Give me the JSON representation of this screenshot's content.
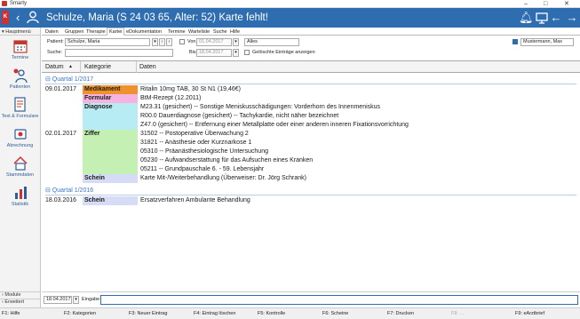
{
  "window": {
    "title": "Smarty",
    "controls": [
      "–",
      "□",
      "✕"
    ]
  },
  "header": {
    "red_tab": "K",
    "patient_title": "Schulze, Maria (S 24 03 65, Alter: 52) Karte fehlt!",
    "icons": [
      "bell-icon",
      "screen-icon",
      "back-icon",
      "forward-icon",
      "menu-icon"
    ]
  },
  "sidebar": {
    "title": "Hauptmenü",
    "items": [
      {
        "label": "Termine",
        "icon": "calendar-icon"
      },
      {
        "label": "Patienten",
        "icon": "patients-icon"
      },
      {
        "label": "Text & Formulare",
        "icon": "document-icon"
      },
      {
        "label": "Abrechnung",
        "icon": "billing-icon"
      },
      {
        "label": "Stammdaten",
        "icon": "house-icon"
      },
      {
        "label": "Statistik",
        "icon": "chart-icon"
      }
    ],
    "bottom": [
      "Module",
      "Erweitert"
    ]
  },
  "tabs": [
    "Daten",
    "Gruppen",
    "Therapie",
    "Kartei",
    "eDokumentation",
    "Termine",
    "Warteliste",
    "Suche",
    "Hilfe"
  ],
  "active_tab": "Kartei",
  "filter": {
    "patient_label": "Patient:",
    "patient_value": "Schulze, Maria",
    "search_label": "Suche:",
    "search_value": "",
    "von_label": "Von",
    "von_value": "01.04.2017",
    "bis_label": "Bis",
    "bis_value": "18.04.2017",
    "type_value": "Alles",
    "deleted_label": "Gelöschte Einträge anzeigen",
    "doctor_value": "Mustermann, Max"
  },
  "grid": {
    "headers": [
      "Datum",
      "Kategorie",
      "Daten"
    ],
    "groups": [
      {
        "label": "Quartal 1/2017",
        "rows": [
          {
            "date": "09.01.2017",
            "kat": "Medikament",
            "color": "#f0922b",
            "data": [
              "Ritalin 10mg TAB, 30 St N1 (19,46€)"
            ]
          },
          {
            "date": "",
            "kat": "Formular",
            "color": "#f6b3e2",
            "data": [
              "BtM-Rezept (12.2011)"
            ]
          },
          {
            "date": "",
            "kat": "Diagnose",
            "color": "#b8ecf4",
            "data": [
              "M23.31 (gesichert) -- Sonstige Meniskusschädigungen: Vorderhorn des Innenmeniskus",
              "R00.0 Dauerdiagnose (gesichert) -- Tachykardie, nicht näher bezeichnet",
              "Z47.0 (gesichert) -- Entfernung einer Metallplatte oder einer anderen inneren Fixationsvorrichtung"
            ]
          },
          {
            "date": "02.01.2017",
            "kat": "Ziffer",
            "color": "#c5f0b4",
            "data": [
              "31502   -- Postoperative Überwachung 2",
              "31821   -- Anästhesie oder Kurznarkose 1",
              "05310   -- Präanästhesiologische Untersuchung",
              "05230   -- Aufwandserstattung für das Aufsuchen eines Kranken",
              "05211   -- Grundpauschale 6. - 59. Lebensjahr"
            ]
          },
          {
            "date": "",
            "kat": "Schein",
            "color": "#d7dcf6",
            "data": [
              "Karte Mit-/Weiterbehandlung (Überweiser: Dr. Jörg Schrank)"
            ]
          }
        ]
      },
      {
        "label": "Quartal 1/2016",
        "rows": [
          {
            "date": "18.03.2016",
            "kat": "Schein",
            "color": "#d7dcf6",
            "data": [
              "Ersatzverfahren Ambulante Behandlung"
            ]
          }
        ]
      }
    ]
  },
  "bottom": {
    "date_value": "18.04.2017",
    "input_label": "Eingabe"
  },
  "fkeys": [
    {
      "label": "F1: Hilfe",
      "enabled": true
    },
    {
      "label": "F2: Kategorien",
      "enabled": true
    },
    {
      "label": "F3: Neuer Eintrag",
      "enabled": true
    },
    {
      "label": "F4: Eintrag löschen",
      "enabled": true
    },
    {
      "label": "F5: Kontrolle",
      "enabled": true
    },
    {
      "label": "F6: Scheine",
      "enabled": true
    },
    {
      "label": "F7: Drucken",
      "enabled": true
    },
    {
      "label": "F8: ...",
      "enabled": false
    },
    {
      "label": "F9: eArztbrief",
      "enabled": true
    }
  ]
}
